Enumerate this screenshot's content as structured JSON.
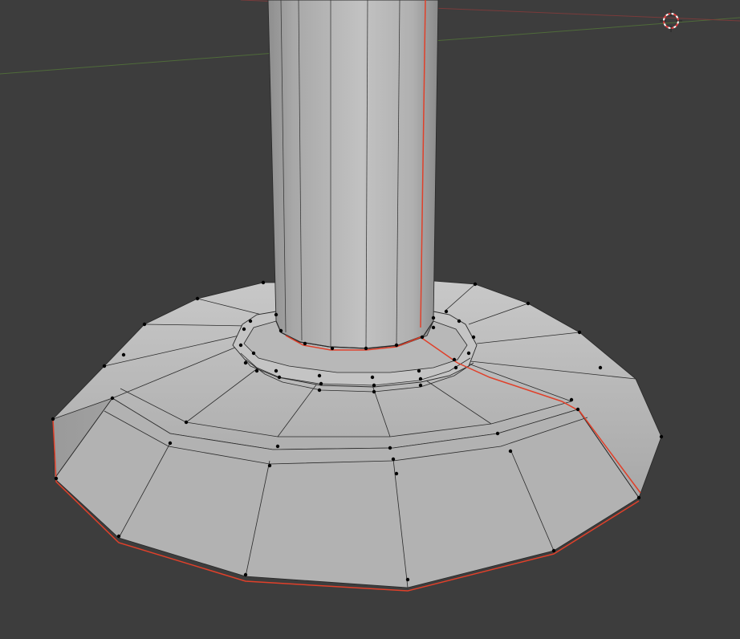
{
  "viewport": {
    "mode": "edit",
    "shading": "solid",
    "background_color": "#3d3d3d",
    "mesh_color": "#b4b4b4",
    "wire_color": "#2a2a2a",
    "vertex_color": "#000000",
    "seam_color": "#e0402a",
    "axis_x_color": "#7a3b3b",
    "axis_y_color": "#4f6b3a",
    "cursor_color": "#e04040"
  },
  "objects": [
    {
      "name": "column-mesh",
      "icon": "mesh-icon"
    }
  ],
  "tools": [
    {
      "name": "3d-cursor",
      "icon": "cursor-crosshair-icon"
    }
  ]
}
